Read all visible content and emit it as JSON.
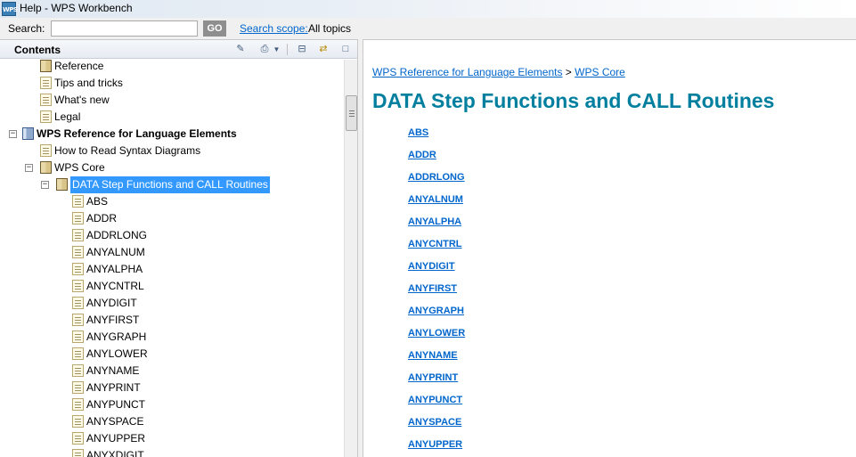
{
  "window": {
    "title": "Help - WPS Workbench",
    "app_icon": "WPS"
  },
  "search": {
    "label": "Search:",
    "value": "",
    "placeholder": "",
    "go_label": "GO",
    "scope_link": "Search scope:",
    "scope_value": "All topics"
  },
  "contents_pane": {
    "title": "Contents",
    "toolbar_icons": [
      "show-in-toc-icon",
      "print-icon",
      "dropdown-arrow-icon",
      "collapse-all-icon",
      "link-with-contents-icon",
      "maximize-icon"
    ],
    "tree": [
      {
        "label": "Reference",
        "icon": "book-icon",
        "depth": 1,
        "toggle": "",
        "bold": false,
        "selected": false
      },
      {
        "label": "Tips and tricks",
        "icon": "page-icon",
        "depth": 1,
        "toggle": "",
        "bold": false,
        "selected": false
      },
      {
        "label": "What's new",
        "icon": "page-icon",
        "depth": 1,
        "toggle": "",
        "bold": false,
        "selected": false
      },
      {
        "label": "Legal",
        "icon": "page-icon",
        "depth": 1,
        "toggle": "",
        "bold": false,
        "selected": false
      },
      {
        "label": "WPS Reference for Language Elements",
        "icon": "book-blue-icon",
        "depth": 0,
        "toggle": "−",
        "bold": true,
        "selected": false
      },
      {
        "label": "How to Read Syntax Diagrams",
        "icon": "page-icon",
        "depth": 1,
        "toggle": "",
        "bold": false,
        "selected": false
      },
      {
        "label": "WPS Core",
        "icon": "book-icon",
        "depth": 1,
        "toggle": "−",
        "bold": false,
        "selected": false
      },
      {
        "label": "DATA Step Functions and CALL Routines",
        "icon": "book-icon",
        "depth": 2,
        "toggle": "−",
        "bold": false,
        "selected": true
      },
      {
        "label": "ABS",
        "icon": "page-icon",
        "depth": 3,
        "toggle": "",
        "bold": false,
        "selected": false
      },
      {
        "label": "ADDR",
        "icon": "page-icon",
        "depth": 3,
        "toggle": "",
        "bold": false,
        "selected": false
      },
      {
        "label": "ADDRLONG",
        "icon": "page-icon",
        "depth": 3,
        "toggle": "",
        "bold": false,
        "selected": false
      },
      {
        "label": "ANYALNUM",
        "icon": "page-icon",
        "depth": 3,
        "toggle": "",
        "bold": false,
        "selected": false
      },
      {
        "label": "ANYALPHA",
        "icon": "page-icon",
        "depth": 3,
        "toggle": "",
        "bold": false,
        "selected": false
      },
      {
        "label": "ANYCNTRL",
        "icon": "page-icon",
        "depth": 3,
        "toggle": "",
        "bold": false,
        "selected": false
      },
      {
        "label": "ANYDIGIT",
        "icon": "page-icon",
        "depth": 3,
        "toggle": "",
        "bold": false,
        "selected": false
      },
      {
        "label": "ANYFIRST",
        "icon": "page-icon",
        "depth": 3,
        "toggle": "",
        "bold": false,
        "selected": false
      },
      {
        "label": "ANYGRAPH",
        "icon": "page-icon",
        "depth": 3,
        "toggle": "",
        "bold": false,
        "selected": false
      },
      {
        "label": "ANYLOWER",
        "icon": "page-icon",
        "depth": 3,
        "toggle": "",
        "bold": false,
        "selected": false
      },
      {
        "label": "ANYNAME",
        "icon": "page-icon",
        "depth": 3,
        "toggle": "",
        "bold": false,
        "selected": false
      },
      {
        "label": "ANYPRINT",
        "icon": "page-icon",
        "depth": 3,
        "toggle": "",
        "bold": false,
        "selected": false
      },
      {
        "label": "ANYPUNCT",
        "icon": "page-icon",
        "depth": 3,
        "toggle": "",
        "bold": false,
        "selected": false
      },
      {
        "label": "ANYSPACE",
        "icon": "page-icon",
        "depth": 3,
        "toggle": "",
        "bold": false,
        "selected": false
      },
      {
        "label": "ANYUPPER",
        "icon": "page-icon",
        "depth": 3,
        "toggle": "",
        "bold": false,
        "selected": false
      },
      {
        "label": "ANYXDIGIT",
        "icon": "page-icon",
        "depth": 3,
        "toggle": "",
        "bold": false,
        "selected": false
      }
    ]
  },
  "content": {
    "breadcrumb": {
      "items": [
        "WPS Reference for Language Elements",
        "WPS Core"
      ],
      "separator": ">"
    },
    "heading": "DATA Step Functions and CALL Routines",
    "heading_color": "#007f9f",
    "link_color": "#0066cc",
    "links": [
      "ABS",
      "ADDR",
      "ADDRLONG",
      "ANYALNUM",
      "ANYALPHA",
      "ANYCNTRL",
      "ANYDIGIT",
      "ANYFIRST",
      "ANYGRAPH",
      "ANYLOWER",
      "ANYNAME",
      "ANYPRINT",
      "ANYPUNCT",
      "ANYSPACE",
      "ANYUPPER"
    ]
  }
}
